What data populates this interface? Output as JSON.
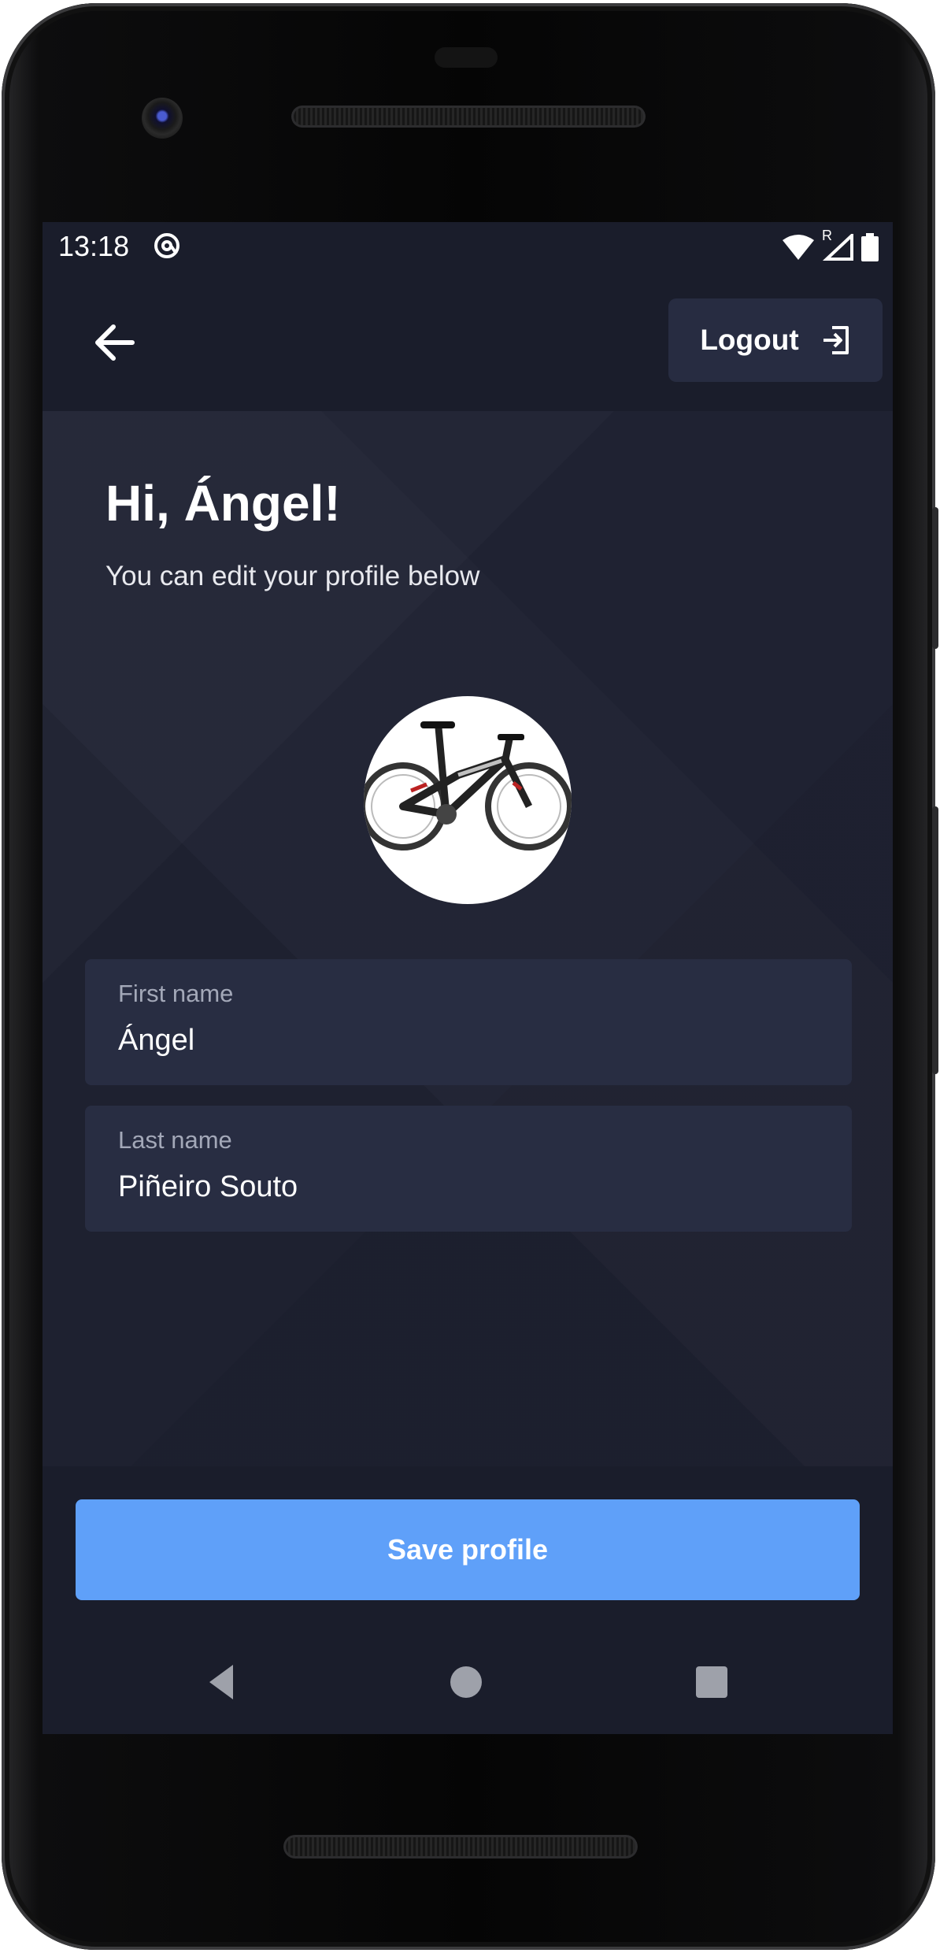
{
  "status_bar": {
    "time": "13:18",
    "network_badge": "R"
  },
  "app_bar": {
    "logout_label": "Logout"
  },
  "profile": {
    "greeting": "Hi, Ángel!",
    "subtitle": "You can edit your profile below",
    "first_name": {
      "label": "First name",
      "value": "Ángel"
    },
    "last_name": {
      "label": "Last name",
      "value": "Piñeiro Souto"
    }
  },
  "actions": {
    "save_label": "Save profile"
  },
  "icons": {
    "back": "arrow-left-icon",
    "logout": "logout-icon",
    "avatar": "bicycle-image",
    "status_wifi": "wifi-icon",
    "status_signal": "signal-icon",
    "status_battery": "battery-icon",
    "status_app": "at-icon"
  },
  "colors": {
    "background": "#1f2232",
    "appbar": "#1a1d2b",
    "field": "#282d42",
    "logout_button": "#272c41",
    "primary": "#5fa0f9",
    "label_text": "#a3a8b8"
  }
}
